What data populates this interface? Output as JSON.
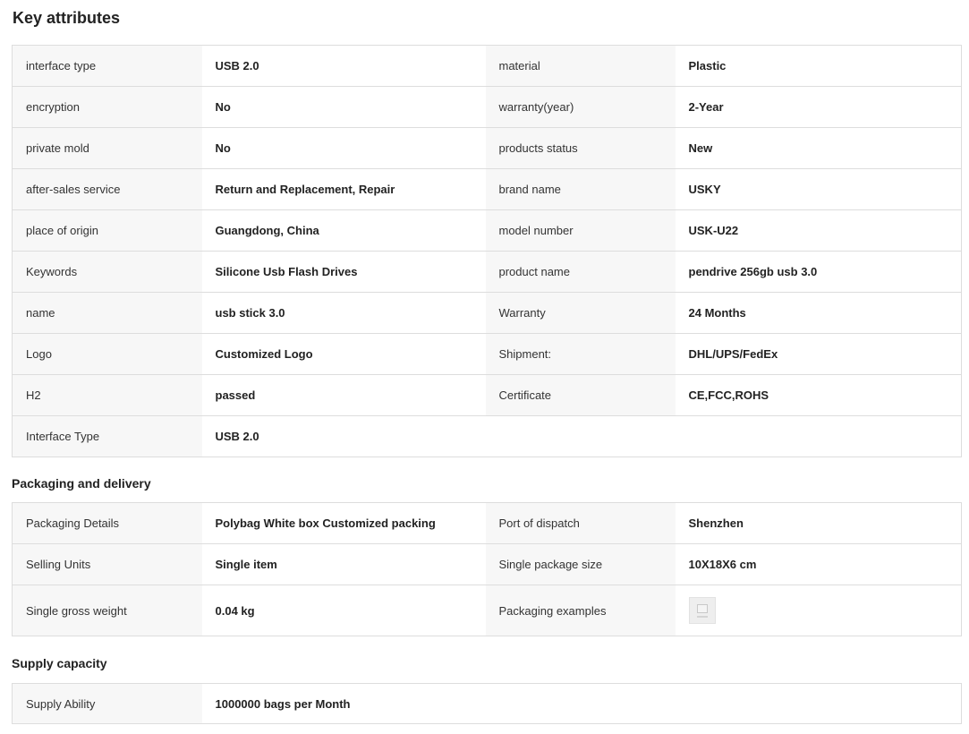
{
  "key_attributes": {
    "title": "Key attributes",
    "rows": [
      [
        "interface type",
        "USB 2.0",
        "material",
        "Plastic"
      ],
      [
        "encryption",
        "No",
        "warranty(year)",
        "2-Year"
      ],
      [
        "private mold",
        "No",
        "products status",
        "New"
      ],
      [
        "after-sales service",
        "Return and Replacement, Repair",
        "brand name",
        "USKY"
      ],
      [
        "place of origin",
        "Guangdong, China",
        "model number",
        "USK-U22"
      ],
      [
        "Keywords",
        "Silicone Usb Flash Drives",
        "product name",
        "pendrive 256gb usb 3.0"
      ],
      [
        "name",
        "usb stick 3.0",
        "Warranty",
        "24 Months"
      ],
      [
        "Logo",
        "Customized Logo",
        "Shipment:",
        "DHL/UPS/FedEx"
      ],
      [
        "H2",
        "passed",
        "Certificate",
        "CE,FCC,ROHS"
      ],
      [
        "Interface Type",
        "USB 2.0",
        "",
        ""
      ]
    ]
  },
  "packaging": {
    "title": "Packaging and delivery",
    "rows": [
      [
        "Packaging Details",
        "Polybag White box Customized packing",
        "Port of dispatch",
        "Shenzhen"
      ],
      [
        "Selling Units",
        "Single item",
        "Single package size",
        "10X18X6 cm"
      ],
      [
        "Single gross weight",
        "0.04 kg",
        "Packaging examples",
        ""
      ]
    ]
  },
  "supply": {
    "title": "Supply capacity",
    "rows": [
      [
        "Supply Ability",
        "1000000 bags per Month",
        "",
        ""
      ]
    ]
  },
  "colors": {
    "label_bg": "#f7f7f7",
    "border": "#dddddd",
    "text": "#222222"
  },
  "icons": {
    "packaging_example": "packaging-example-thumbnail"
  }
}
